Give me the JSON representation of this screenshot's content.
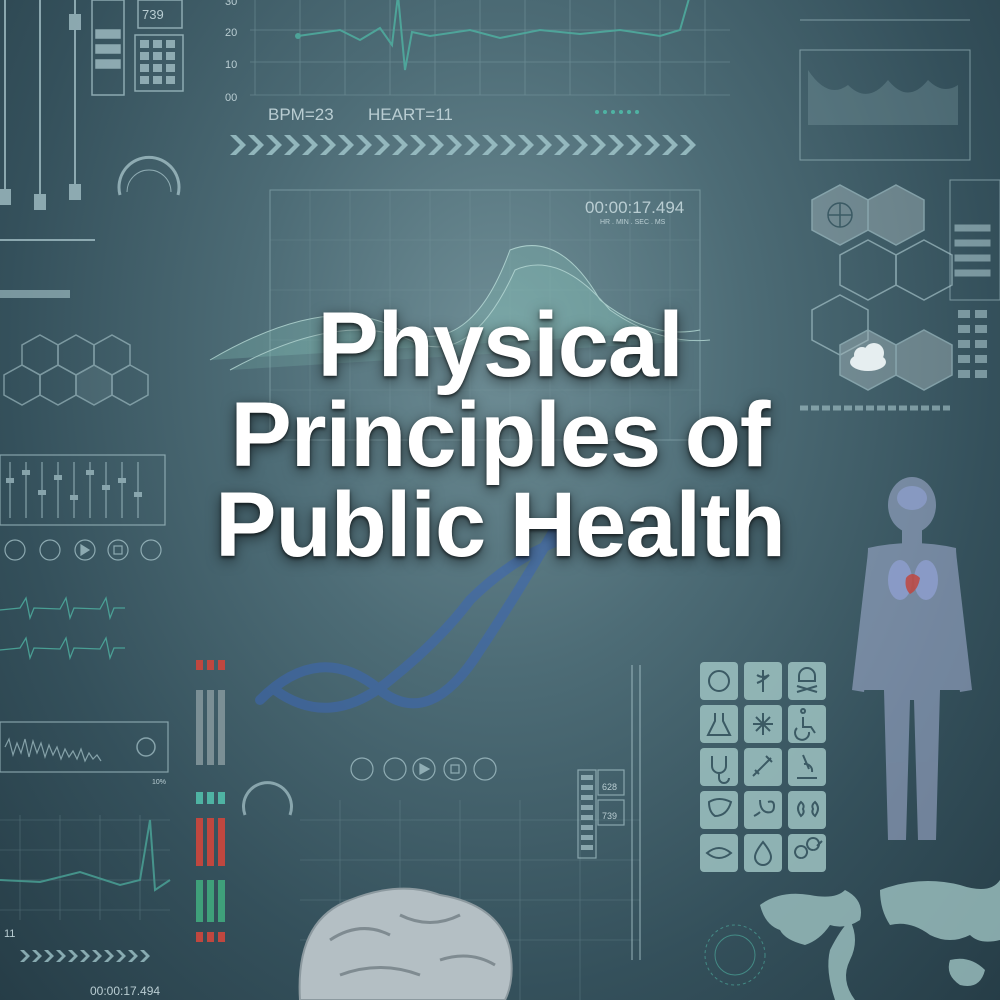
{
  "title": {
    "lines": [
      "Physical",
      "Principles of",
      "Public Health"
    ]
  },
  "hud": {
    "bpm_readout": "BPM=23",
    "heart_readout": "HEART=11",
    "timer_main": "00:00:17.494",
    "timer_units": "HR . MIN . SEC . MS",
    "timer_bottom": "00:00:17.494",
    "keypad_value": "739",
    "scale_30": "30",
    "scale_20": "20",
    "scale_10": "10",
    "scale_00": "00",
    "counter_left": "11",
    "meter_value_1": "628",
    "meter_value_2": "739",
    "wave_percent": "10%"
  },
  "colors": {
    "background": "#3b5a64",
    "hud_line": "#a9c6cc",
    "accent_teal": "#4fb3a3",
    "accent_red": "#c0473f",
    "title": "#ffffff"
  }
}
